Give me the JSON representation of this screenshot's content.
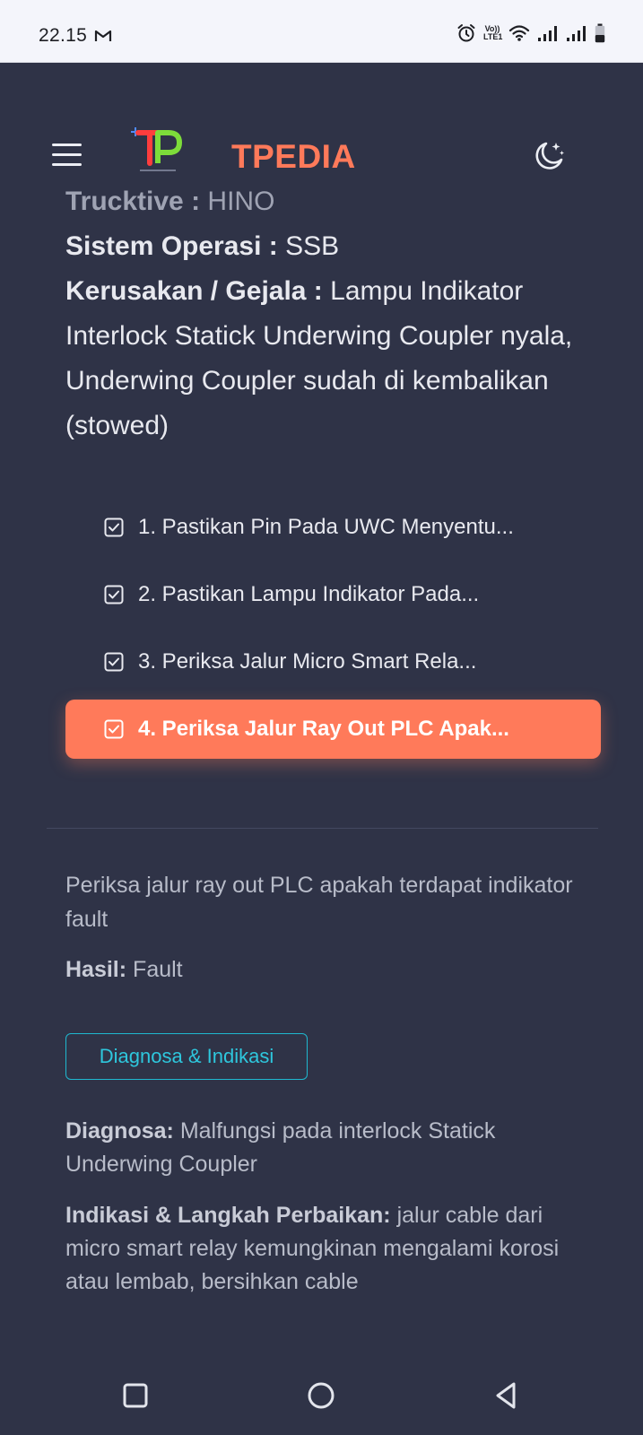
{
  "status_bar": {
    "time": "22.15",
    "lte_top": "Vo))",
    "lte_bottom": "LTE1"
  },
  "header": {
    "brand": "TPEDIA",
    "menu_icon": "hamburger-icon",
    "theme_icon": "moon-stars-icon",
    "colors": {
      "brand": "#ff7a5a",
      "background": "#2f3347"
    }
  },
  "info": {
    "trucktive_label": "Trucktive :",
    "trucktive_value": "HINO",
    "os_label": "Sistem Operasi :",
    "os_value": "SSB",
    "damage_label": "Kerusakan / Gejala :",
    "damage_value": "Lampu Indikator Interlock Statick Underwing Coupler nyala, Underwing Coupler sudah di kembalikan (stowed)"
  },
  "steps": [
    {
      "label": "1. Pastikan Pin Pada UWC Menyentu...",
      "active": false
    },
    {
      "label": "2. Pastikan Lampu Indikator Pada...",
      "active": false
    },
    {
      "label": "3. Periksa Jalur Micro Smart Rela...",
      "active": false
    },
    {
      "label": "4. Periksa Jalur Ray Out PLC Apak...",
      "active": true
    }
  ],
  "detail": {
    "description": "Periksa jalur ray out PLC apakah terdapat indikator fault",
    "result_label": "Hasil:",
    "result_value": "Fault"
  },
  "diagnosis_button": "Diagnosa & Indikasi",
  "diagnosis": {
    "diagnosa_label": "Diagnosa:",
    "diagnosa_value": "Malfungsi pada interlock Statick Underwing Coupler",
    "fix_label": "Indikasi & Langkah Perbaikan:",
    "fix_value": "jalur cable dari micro smart relay kemungkinan mengalami korosi atau lembab, bersihkan cable"
  },
  "nav": {
    "recent_icon": "square-recents-icon",
    "home_icon": "circle-home-icon",
    "back_icon": "triangle-back-icon"
  }
}
